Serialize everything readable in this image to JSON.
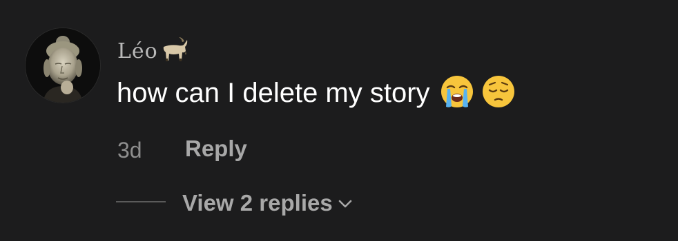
{
  "comment": {
    "username": "Léo",
    "username_emoji_icon": "goat-icon",
    "text": "how can I delete my story",
    "emojis": [
      "loudly-crying-face-icon",
      "pensive-face-icon"
    ],
    "timestamp": "3d",
    "reply_label": "Reply",
    "view_replies_label": "View 2 replies"
  },
  "colors": {
    "background": "#1c1c1d",
    "text": "#ffffff",
    "muted": "#8e8e8e",
    "action": "#a8a8a8"
  }
}
